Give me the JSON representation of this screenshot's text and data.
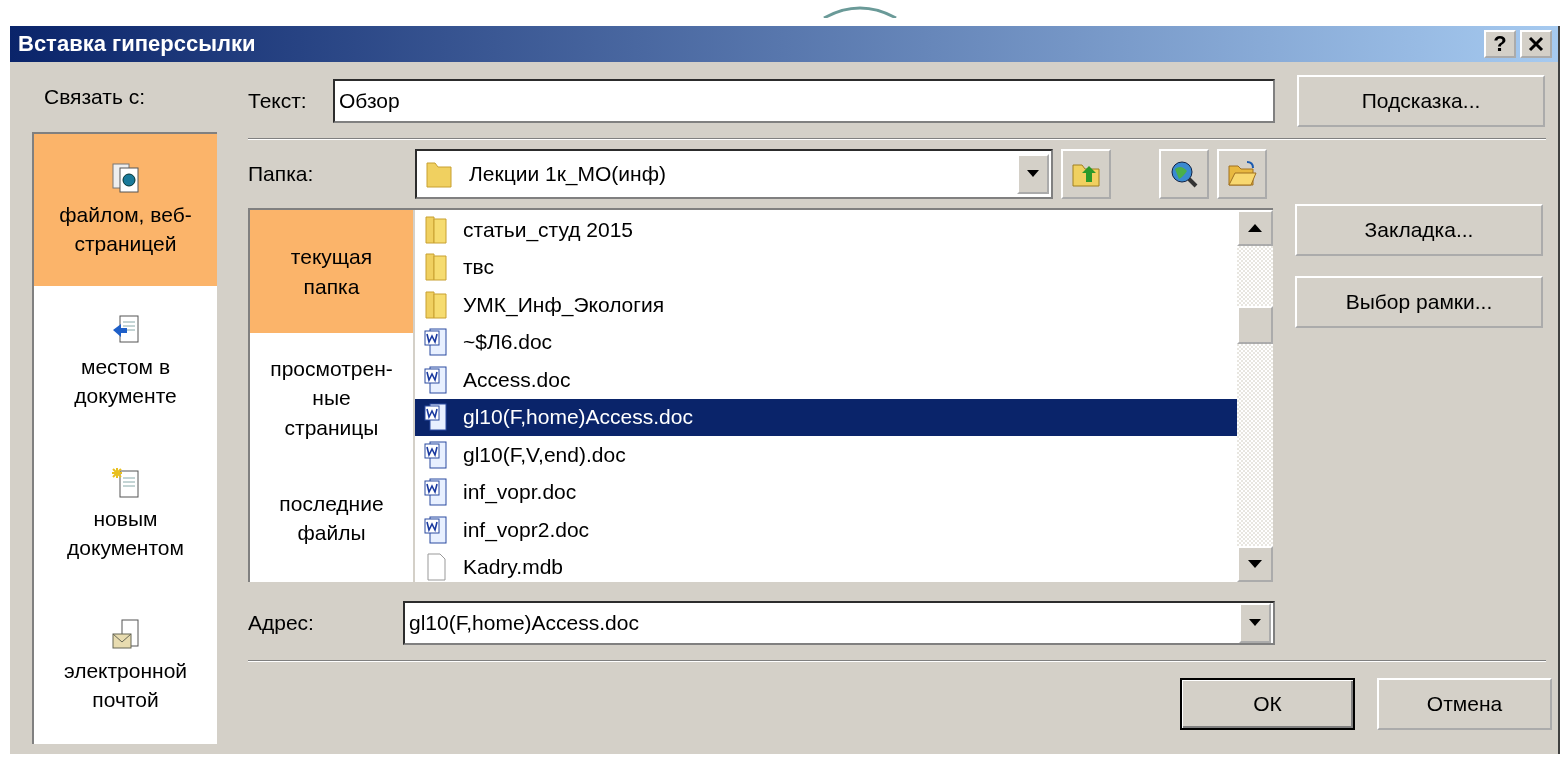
{
  "window": {
    "title": "Вставка гиперссылки",
    "help": "?"
  },
  "link_to": {
    "label": "Связать с:",
    "items": [
      {
        "kind": "file",
        "label": "файлом, веб-\nстраницей",
        "selected": true
      },
      {
        "kind": "place",
        "label": "местом в\nдокументе",
        "selected": false
      },
      {
        "kind": "new",
        "label": "новым\nдокументом",
        "selected": false
      },
      {
        "kind": "email",
        "label": "электронной\nпочтой",
        "selected": false
      }
    ]
  },
  "text_field": {
    "label": "Текст:",
    "value": "Обзор"
  },
  "folder": {
    "label": "Папка:",
    "value": "Лекции 1к_МО(инф)"
  },
  "browse": {
    "items": [
      {
        "label": "текущая\nпапка",
        "selected": true
      },
      {
        "label": "просмотрен-\nные\nстраницы",
        "selected": false
      },
      {
        "label": "последние\nфайлы",
        "selected": false
      }
    ]
  },
  "files": [
    {
      "kind": "folder",
      "name": "статьи_студ 2015",
      "selected": false
    },
    {
      "kind": "folder",
      "name": "твс",
      "selected": false
    },
    {
      "kind": "folder",
      "name": "УМК_Инф_Экология",
      "selected": false
    },
    {
      "kind": "word",
      "name": "~$Л6.doc",
      "selected": false
    },
    {
      "kind": "word",
      "name": "Access.doc",
      "selected": false
    },
    {
      "kind": "word",
      "name": "gl10(F,home)Access.doc",
      "selected": true
    },
    {
      "kind": "word",
      "name": "gl10(F,V,end).doc",
      "selected": false
    },
    {
      "kind": "word",
      "name": "inf_vopr.doc",
      "selected": false
    },
    {
      "kind": "word",
      "name": "inf_vopr2.doc",
      "selected": false
    },
    {
      "kind": "blank",
      "name": "Kadry.mdb",
      "selected": false
    }
  ],
  "address": {
    "label": "Адрес:",
    "value": "gl10(F,home)Access.doc"
  },
  "side_buttons": [
    "Подсказка...",
    "Закладка...",
    "Выбор рамки..."
  ],
  "buttons": [
    "ОК",
    "Отмена"
  ]
}
